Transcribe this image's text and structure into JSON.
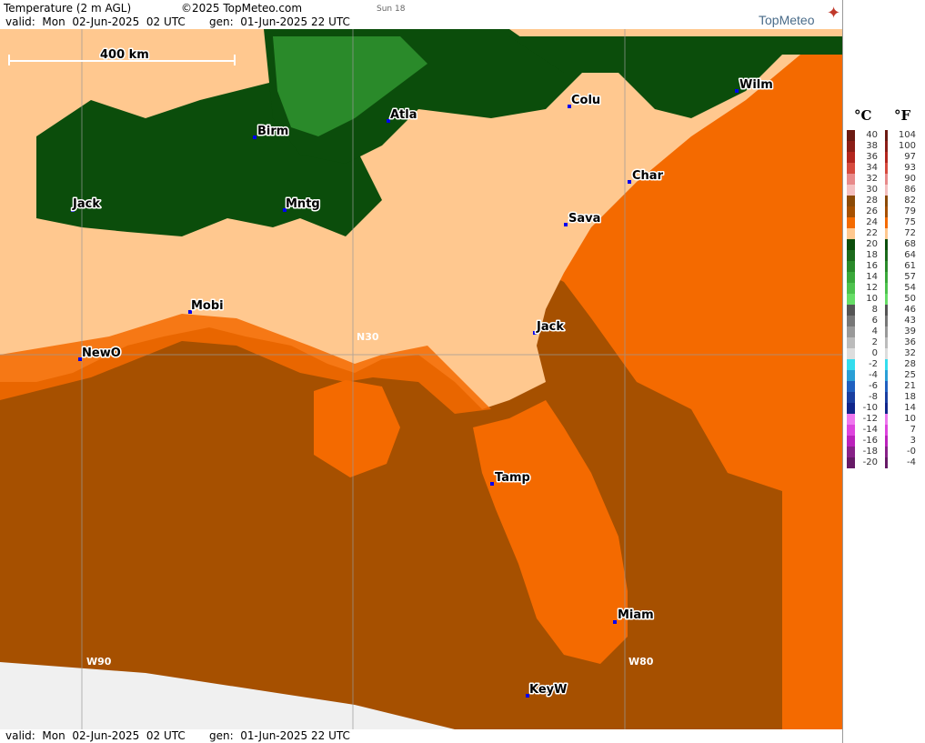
{
  "header": {
    "product": "Temperature (2 m AGL)",
    "copyright": "©2025 TopMeteo.com",
    "day": "Sun 18",
    "valid": "valid:  Mon  02-Jun-2025  02 UTC",
    "gen": "gen:  01-Jun-2025 22 UTC",
    "brand": "TopMeteo"
  },
  "footer": {
    "valid": "valid:  Mon  02-Jun-2025  02 UTC",
    "gen": "gen:  01-Jun-2025 22 UTC"
  },
  "map": {
    "scale_label": "400 km",
    "grid_labels": {
      "lat": "N30",
      "lon_w90": "W90",
      "lon_w80": "W80"
    },
    "cities": [
      "Birm",
      "Atla",
      "Colu",
      "Wilm",
      "Char",
      "Sava",
      "Jack",
      "Mntg",
      "Mobi",
      "NewO",
      "Jack",
      "Tamp",
      "Miam",
      "KeyW"
    ]
  },
  "legend": {
    "celsius_label": "°C",
    "fahrenheit_label": "°F",
    "celsius": [
      "40",
      "38",
      "36",
      "34",
      "32",
      "30",
      "28",
      "26",
      "24",
      "22",
      "20",
      "18",
      "16",
      "14",
      "12",
      "10",
      "8",
      "6",
      "4",
      "2",
      "0",
      "-2",
      "-4",
      "-6",
      "-8",
      "-10",
      "-12",
      "-14",
      "-16",
      "-18",
      "-20"
    ],
    "fahrenheit": [
      "104",
      "100",
      "97",
      "93",
      "90",
      "86",
      "82",
      "79",
      "75",
      "72",
      "68",
      "64",
      "61",
      "57",
      "54",
      "50",
      "46",
      "43",
      "39",
      "36",
      "32",
      "28",
      "25",
      "21",
      "18",
      "14",
      "10",
      "7",
      "3",
      "-0",
      "-4"
    ],
    "colors": [
      "#6b1a12",
      "#8b1e17",
      "#b3261e",
      "#d64a3e",
      "#e88a8a",
      "#f4c0c0",
      "#8b4a06",
      "#a65000",
      "#f46a00",
      "#ffc88f",
      "#0b4d0b",
      "#1c6b1c",
      "#2a8a2a",
      "#3aa83a",
      "#4dc24d",
      "#66dd66",
      "#555555",
      "#777777",
      "#999999",
      "#bbbbbb",
      "#dddddd",
      "#33ddee",
      "#2a9fd6",
      "#2060c0",
      "#1a3fa0",
      "#10258a",
      "#ee77ee",
      "#dd44dd",
      "#bb22bb",
      "#882288",
      "#661a66"
    ]
  }
}
